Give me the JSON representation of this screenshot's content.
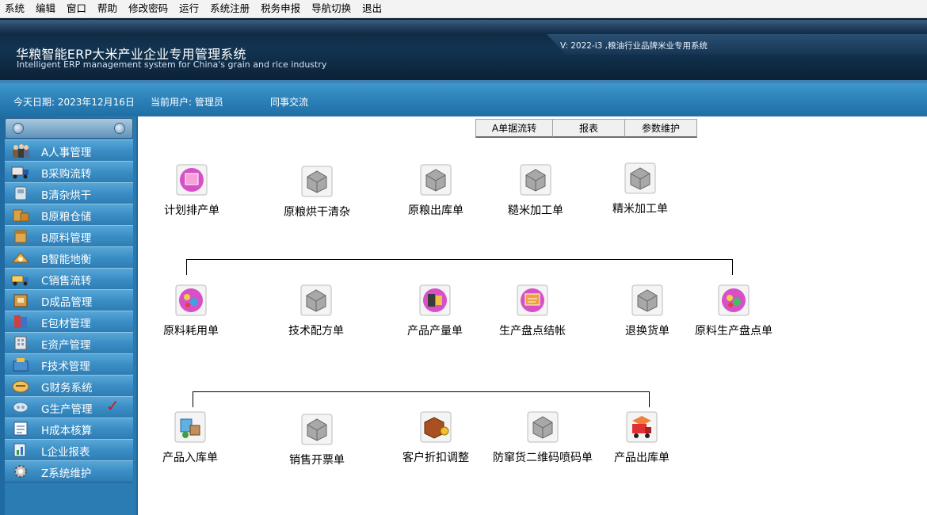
{
  "menubar": [
    "系统",
    "编辑",
    "窗口",
    "帮助",
    "修改密码",
    "运行",
    "系统注册",
    "税务申报",
    "导航切换",
    "退出"
  ],
  "header": {
    "title_cn": "华粮智能ERP大米产业企业专用管理系统",
    "title_en": "Intelligent ERP management system for China's grain and rice industry",
    "version": "V: 2022-i3 ,粮油行业品牌米业专用系统"
  },
  "infobar": {
    "date": "今天日期: 2023年12月16日",
    "user": "当前用户: 管理员",
    "exchange": "同事交流"
  },
  "sidebar": {
    "items": [
      {
        "label": "A人事管理",
        "icon": "people-icon"
      },
      {
        "label": "B采购流转",
        "icon": "truck-icon"
      },
      {
        "label": "B清杂烘干",
        "icon": "machine-icon"
      },
      {
        "label": "B原粮仓储",
        "icon": "boxes-icon"
      },
      {
        "label": "B原料管理",
        "icon": "box-icon"
      },
      {
        "label": "B智能地衡",
        "icon": "scale-icon"
      },
      {
        "label": "C销售流转",
        "icon": "delivery-truck-icon"
      },
      {
        "label": "D成品管理",
        "icon": "product-box-icon"
      },
      {
        "label": "E包材管理",
        "icon": "package-icon"
      },
      {
        "label": "E资产管理",
        "icon": "building-icon"
      },
      {
        "label": "F技术管理",
        "icon": "tech-icon"
      },
      {
        "label": "G财务系统",
        "icon": "finance-icon"
      },
      {
        "label": "G生产管理",
        "icon": "production-icon",
        "active": true
      },
      {
        "label": "H成本核算",
        "icon": "ledger-icon"
      },
      {
        "label": "L企业报表",
        "icon": "report-icon"
      },
      {
        "label": "Z系统维护",
        "icon": "gear-icon"
      }
    ],
    "check_mark": "✓"
  },
  "toolbar": {
    "btn1": "A单据流转",
    "btn2": "报表",
    "btn3": "参数维护"
  },
  "flow": {
    "row1": [
      {
        "label": "计划排产单",
        "icon": "plan-icon",
        "style": "pink"
      },
      {
        "label": "原粮烘干清杂",
        "icon": "gray-box-icon",
        "style": "gray"
      },
      {
        "label": "原粮出库单",
        "icon": "gray-box-icon",
        "style": "gray"
      },
      {
        "label": "糙米加工单",
        "icon": "gray-box-icon",
        "style": "gray"
      },
      {
        "label": "精米加工单",
        "icon": "gray-box-icon",
        "style": "gray"
      }
    ],
    "row2": [
      {
        "label": "原料耗用单",
        "icon": "material-use-icon",
        "style": "pink"
      },
      {
        "label": "技术配方单",
        "icon": "gray-box-icon",
        "style": "gray"
      },
      {
        "label": "产品产量单",
        "icon": "output-icon",
        "style": "pink"
      },
      {
        "label": "生产盘点结帐",
        "icon": "inventory-icon",
        "style": "pink"
      },
      {
        "label": "退换货单",
        "icon": "gray-box-icon",
        "style": "gray"
      },
      {
        "label": "原料生产盘点单",
        "icon": "material-inventory-icon",
        "style": "pink"
      }
    ],
    "row3": [
      {
        "label": "产品入库单",
        "icon": "stock-in-icon",
        "style": "blue"
      },
      {
        "label": "销售开票单",
        "icon": "gray-box-icon",
        "style": "gray"
      },
      {
        "label": "客户折扣调整",
        "icon": "discount-icon",
        "style": "orange"
      },
      {
        "label": "防窜货二维码喷码单",
        "icon": "gray-box-icon",
        "style": "gray"
      },
      {
        "label": "产品出库单",
        "icon": "stock-out-icon",
        "style": "red"
      }
    ]
  }
}
